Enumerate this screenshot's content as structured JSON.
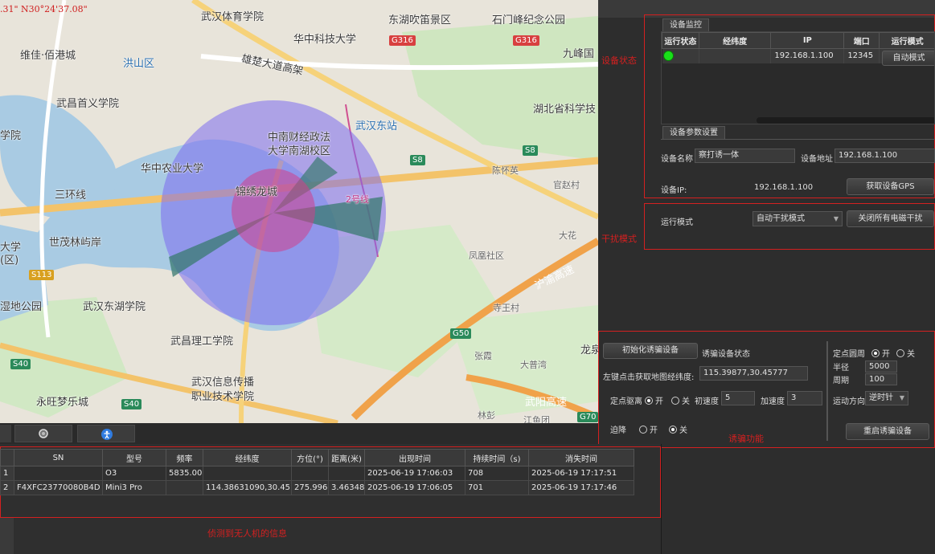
{
  "map": {
    "coord_readout": ".31\" N30°24'37.08\"",
    "labels": [
      "武汉体育学院",
      "华中科技大学",
      "东湖吹笛景区",
      "石门峰纪念公园",
      "维佳·佰港城",
      "洪山区",
      "九峰国",
      "雄楚大道高架",
      "武昌首义学院",
      "湖北省科学技",
      "武汉东站",
      "中南财经政法",
      "大学南湖校区",
      "学院",
      "华中农业大学",
      "锦绣龙城",
      "三环线",
      "陈怀英",
      "官赵村",
      "世茂林屿岸",
      "大学",
      "(区)",
      "大花",
      "凤凰社区",
      "沪渝高速",
      "寺王村",
      "湿地公园",
      "武汉东湖学院",
      "武昌理工学院",
      "龙泉",
      "张霞",
      "大普湾",
      "武汉信息传播",
      "职业技术学院",
      "武阳高速",
      "永旺梦乐城",
      "林彭",
      "江鱼团"
    ],
    "road_tags": [
      "G316",
      "G316",
      "S8",
      "S8",
      "S113",
      "G50",
      "S40",
      "S40",
      "G70"
    ],
    "line_label": "2号线"
  },
  "map_toolbar": {
    "search_icon": "search-icon",
    "locate_icon": "accessibility-icon"
  },
  "device_status": {
    "section_label": "设备状态",
    "tab_label": "设备监控",
    "columns": [
      "运行状态",
      "经纬度",
      "IP",
      "端口",
      "运行模式"
    ],
    "rows": [
      {
        "status_color": "#19e019",
        "latlng": "",
        "ip": "192.168.1.100",
        "port": "12345",
        "mode": "自动模式"
      }
    ],
    "params_tab": "设备参数设置",
    "name_label": "设备名称",
    "name_value": "察打诱一体",
    "addr_label": "设备地址",
    "addr_value": "192.168.1.100",
    "ip_label": "设备IP:",
    "ip_value": "192.168.1.100",
    "gps_button": "获取设备GPS"
  },
  "interference": {
    "section_label": "干扰模式",
    "mode_label": "运行模式",
    "mode_value": "自动干扰模式",
    "close_button": "关闭所有电磁干扰"
  },
  "spoof": {
    "section_label": "诱骗功能",
    "init_button": "初始化诱骗设备",
    "status_label": "诱骗设备状态",
    "click_label": "左键点击获取地图经纬度:",
    "click_value": "115.39877,30.45777",
    "drift_label": "定点驱离",
    "on": "开",
    "off": "关",
    "init_speed_label": "初速度",
    "init_speed_value": "5",
    "accel_label": "加速度",
    "accel_value": "3",
    "force_land_label": "迫降",
    "circle_label": "定点圆周",
    "radius_label": "半径",
    "radius_value": "5000",
    "period_label": "周期",
    "period_value": "100",
    "direction_label": "运动方向",
    "direction_value": "逆时针",
    "restart_button": "重启诱骗设备"
  },
  "drones": {
    "section_label": "侦测到无人机的信息",
    "columns": [
      "",
      "SN",
      "型号",
      "频率",
      "经纬度",
      "方位(°)",
      "距离(米)",
      "出现时间",
      "持续时间（s)",
      "消失时间"
    ],
    "rows": [
      [
        "1",
        "",
        "O3",
        "5835.00",
        "",
        "",
        "",
        "2025-06-19 17:06:03",
        "708",
        "2025-06-19 17:17:51"
      ],
      [
        "2",
        "F4XFC23770080B4D",
        "Mini3 Pro",
        "",
        "114.38631090,30.45...",
        "275.996",
        "3.46348",
        "2025-06-19 17:06:05",
        "701",
        "2025-06-19 17:17:46"
      ]
    ]
  },
  "colors": {
    "accent_red": "#d42020",
    "status_green": "#19e019"
  }
}
